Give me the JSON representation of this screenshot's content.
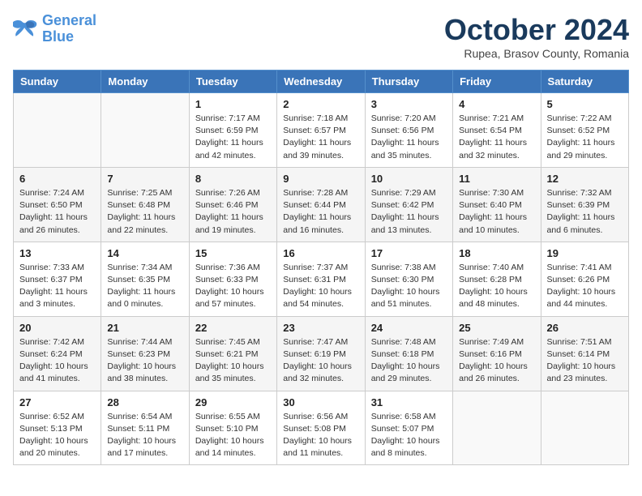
{
  "header": {
    "logo_line1": "General",
    "logo_line2": "Blue",
    "month_title": "October 2024",
    "location": "Rupea, Brasov County, Romania"
  },
  "weekdays": [
    "Sunday",
    "Monday",
    "Tuesday",
    "Wednesday",
    "Thursday",
    "Friday",
    "Saturday"
  ],
  "weeks": [
    [
      {
        "day": "",
        "info": ""
      },
      {
        "day": "",
        "info": ""
      },
      {
        "day": "1",
        "info": "Sunrise: 7:17 AM\nSunset: 6:59 PM\nDaylight: 11 hours and 42 minutes."
      },
      {
        "day": "2",
        "info": "Sunrise: 7:18 AM\nSunset: 6:57 PM\nDaylight: 11 hours and 39 minutes."
      },
      {
        "day": "3",
        "info": "Sunrise: 7:20 AM\nSunset: 6:56 PM\nDaylight: 11 hours and 35 minutes."
      },
      {
        "day": "4",
        "info": "Sunrise: 7:21 AM\nSunset: 6:54 PM\nDaylight: 11 hours and 32 minutes."
      },
      {
        "day": "5",
        "info": "Sunrise: 7:22 AM\nSunset: 6:52 PM\nDaylight: 11 hours and 29 minutes."
      }
    ],
    [
      {
        "day": "6",
        "info": "Sunrise: 7:24 AM\nSunset: 6:50 PM\nDaylight: 11 hours and 26 minutes."
      },
      {
        "day": "7",
        "info": "Sunrise: 7:25 AM\nSunset: 6:48 PM\nDaylight: 11 hours and 22 minutes."
      },
      {
        "day": "8",
        "info": "Sunrise: 7:26 AM\nSunset: 6:46 PM\nDaylight: 11 hours and 19 minutes."
      },
      {
        "day": "9",
        "info": "Sunrise: 7:28 AM\nSunset: 6:44 PM\nDaylight: 11 hours and 16 minutes."
      },
      {
        "day": "10",
        "info": "Sunrise: 7:29 AM\nSunset: 6:42 PM\nDaylight: 11 hours and 13 minutes."
      },
      {
        "day": "11",
        "info": "Sunrise: 7:30 AM\nSunset: 6:40 PM\nDaylight: 11 hours and 10 minutes."
      },
      {
        "day": "12",
        "info": "Sunrise: 7:32 AM\nSunset: 6:39 PM\nDaylight: 11 hours and 6 minutes."
      }
    ],
    [
      {
        "day": "13",
        "info": "Sunrise: 7:33 AM\nSunset: 6:37 PM\nDaylight: 11 hours and 3 minutes."
      },
      {
        "day": "14",
        "info": "Sunrise: 7:34 AM\nSunset: 6:35 PM\nDaylight: 11 hours and 0 minutes."
      },
      {
        "day": "15",
        "info": "Sunrise: 7:36 AM\nSunset: 6:33 PM\nDaylight: 10 hours and 57 minutes."
      },
      {
        "day": "16",
        "info": "Sunrise: 7:37 AM\nSunset: 6:31 PM\nDaylight: 10 hours and 54 minutes."
      },
      {
        "day": "17",
        "info": "Sunrise: 7:38 AM\nSunset: 6:30 PM\nDaylight: 10 hours and 51 minutes."
      },
      {
        "day": "18",
        "info": "Sunrise: 7:40 AM\nSunset: 6:28 PM\nDaylight: 10 hours and 48 minutes."
      },
      {
        "day": "19",
        "info": "Sunrise: 7:41 AM\nSunset: 6:26 PM\nDaylight: 10 hours and 44 minutes."
      }
    ],
    [
      {
        "day": "20",
        "info": "Sunrise: 7:42 AM\nSunset: 6:24 PM\nDaylight: 10 hours and 41 minutes."
      },
      {
        "day": "21",
        "info": "Sunrise: 7:44 AM\nSunset: 6:23 PM\nDaylight: 10 hours and 38 minutes."
      },
      {
        "day": "22",
        "info": "Sunrise: 7:45 AM\nSunset: 6:21 PM\nDaylight: 10 hours and 35 minutes."
      },
      {
        "day": "23",
        "info": "Sunrise: 7:47 AM\nSunset: 6:19 PM\nDaylight: 10 hours and 32 minutes."
      },
      {
        "day": "24",
        "info": "Sunrise: 7:48 AM\nSunset: 6:18 PM\nDaylight: 10 hours and 29 minutes."
      },
      {
        "day": "25",
        "info": "Sunrise: 7:49 AM\nSunset: 6:16 PM\nDaylight: 10 hours and 26 minutes."
      },
      {
        "day": "26",
        "info": "Sunrise: 7:51 AM\nSunset: 6:14 PM\nDaylight: 10 hours and 23 minutes."
      }
    ],
    [
      {
        "day": "27",
        "info": "Sunrise: 6:52 AM\nSunset: 5:13 PM\nDaylight: 10 hours and 20 minutes."
      },
      {
        "day": "28",
        "info": "Sunrise: 6:54 AM\nSunset: 5:11 PM\nDaylight: 10 hours and 17 minutes."
      },
      {
        "day": "29",
        "info": "Sunrise: 6:55 AM\nSunset: 5:10 PM\nDaylight: 10 hours and 14 minutes."
      },
      {
        "day": "30",
        "info": "Sunrise: 6:56 AM\nSunset: 5:08 PM\nDaylight: 10 hours and 11 minutes."
      },
      {
        "day": "31",
        "info": "Sunrise: 6:58 AM\nSunset: 5:07 PM\nDaylight: 10 hours and 8 minutes."
      },
      {
        "day": "",
        "info": ""
      },
      {
        "day": "",
        "info": ""
      }
    ]
  ]
}
